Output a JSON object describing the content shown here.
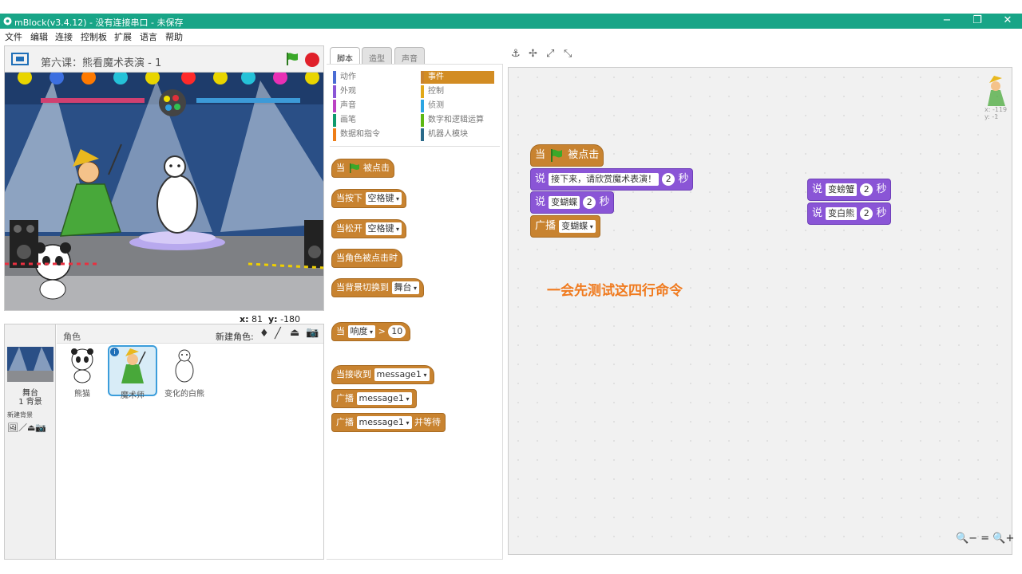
{
  "window": {
    "title": "mBlock(v3.4.12) - 没有连接串口 - 未保存",
    "controls": [
      "−",
      "❐",
      "✕"
    ]
  },
  "menu": [
    "文件",
    "编辑",
    "连接",
    "控制板",
    "扩展",
    "语言",
    "帮助"
  ],
  "stage": {
    "project_title": "第六课：熊看魔术表演 - 1",
    "coord_x_label": "x:",
    "coord_x": "81",
    "coord_y_label": "y:",
    "coord_y": "-180"
  },
  "sprites_panel": {
    "header_label": "角色",
    "new_sprite_label": "新建角色:",
    "stage_label": "舞台",
    "backdrop_count": "1 背景",
    "new_backdrop_label": "新建背景",
    "sprites": [
      {
        "name": "熊猫",
        "selected": false
      },
      {
        "name": "魔术师",
        "selected": true
      },
      {
        "name": "变化的白熊",
        "selected": false
      }
    ]
  },
  "tabs": [
    "脚本",
    "造型",
    "声音"
  ],
  "categories": [
    {
      "label": "动作",
      "color": "#4a6cd4"
    },
    {
      "label": "事件",
      "color": "#c88330",
      "active": true
    },
    {
      "label": "外观",
      "color": "#8a55d6"
    },
    {
      "label": "控制",
      "color": "#e1a91a"
    },
    {
      "label": "声音",
      "color": "#bb42c3"
    },
    {
      "label": "侦测",
      "color": "#2ca5e2"
    },
    {
      "label": "画笔",
      "color": "#0e9a6c"
    },
    {
      "label": "数字和逻辑运算",
      "color": "#5cb712"
    },
    {
      "label": "数据和指令",
      "color": "#ee7d16"
    },
    {
      "label": "机器人模块",
      "color": "#2a6a8a"
    }
  ],
  "palette_blocks": {
    "when_flag": {
      "pre": "当",
      "post": "被点击"
    },
    "when_key": {
      "pre": "当按下",
      "field": "空格键"
    },
    "when_key_release": {
      "pre": "当松开",
      "field": "空格键"
    },
    "when_sprite_clicked": {
      "pre": "当角色被点击时"
    },
    "when_backdrop": {
      "pre": "当背景切换到",
      "field": "舞台"
    },
    "when_loudness": {
      "pre": "当",
      "field": "响度",
      "op": ">",
      "value": "10"
    },
    "when_receive": {
      "pre": "当接收到",
      "field": "message1"
    },
    "broadcast": {
      "pre": "广播",
      "field": "message1"
    },
    "broadcast_wait": {
      "pre": "广播",
      "field": "message1",
      "post": "并等待"
    }
  },
  "script_blocks": {
    "hat": {
      "pre": "当",
      "post": "被点击"
    },
    "say1": {
      "pre": "说",
      "text": "接下来，请欣赏魔术表演！",
      "secs": "2",
      "unit": "秒"
    },
    "say2": {
      "pre": "说",
      "text": "变蝴蝶",
      "secs": "2",
      "unit": "秒"
    },
    "broadcast": {
      "pre": "广播",
      "field": "变蝴蝶"
    },
    "say3": {
      "pre": "说",
      "text": "变螃蟹",
      "secs": "2",
      "unit": "秒"
    },
    "say4": {
      "pre": "说",
      "text": "变白熊",
      "secs": "2",
      "unit": "秒"
    }
  },
  "annotation": "一会先测试这四行命令",
  "sprite_position": {
    "x": "x: -119",
    "y": "y: -1"
  },
  "zoom_controls": [
    "🔍−",
    "=",
    "🔍+"
  ],
  "colors": {
    "titlebar": "#18a587",
    "events": "#c88330",
    "looks": "#8a55d6",
    "annotation": "#f07a1e"
  }
}
